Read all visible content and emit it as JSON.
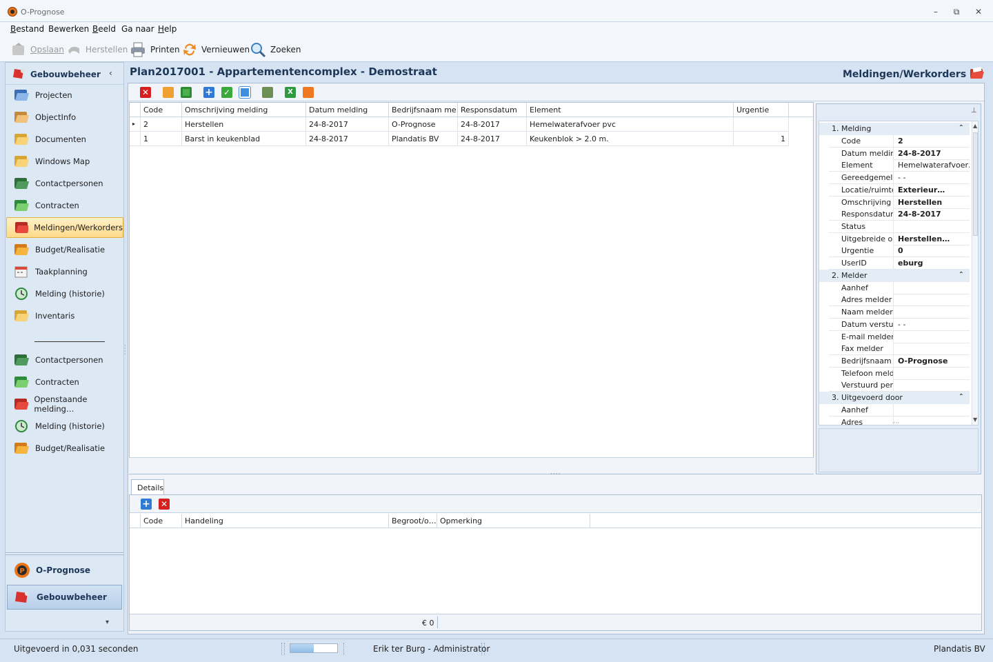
{
  "window": {
    "title": "O-Prognose",
    "minimize": "▭",
    "maximize": "◻",
    "close": "✕"
  },
  "menu": [
    {
      "label": "Bestand",
      "u": "B",
      "rest": "estand"
    },
    {
      "label": "Bewerken",
      "u": "",
      "rest": "Bewerken"
    },
    {
      "label": "Beeld",
      "u": "B",
      "rest": "eeld"
    },
    {
      "label": "Ga naar",
      "u": "",
      "rest": "Ga naar"
    },
    {
      "label": "Help",
      "u": "H",
      "rest": "elp"
    }
  ],
  "toolbar": {
    "save": "Opslaan",
    "undo": "Herstellen",
    "print": "Printen",
    "refresh": "Vernieuwen",
    "search": "Zoeken"
  },
  "sidebar": {
    "title": "Gebouwbeheer",
    "collapse": "‹",
    "items": [
      {
        "label": "Projecten",
        "icon": "projects-icon"
      },
      {
        "label": "ObjectInfo",
        "icon": "objectinfo-icon"
      },
      {
        "label": "Documenten",
        "icon": "folder-icon"
      },
      {
        "label": "Windows Map",
        "icon": "folder-icon"
      },
      {
        "label": "Contactpersonen",
        "icon": "folder-green-icon"
      },
      {
        "label": "Contracten",
        "icon": "folder-check-icon"
      },
      {
        "label": "Meldingen/Werkorders",
        "icon": "folder-red-icon"
      },
      {
        "label": "Budget/Realisatie",
        "icon": "folder-star-icon"
      },
      {
        "label": "Taakplanning",
        "icon": "calendar-icon"
      },
      {
        "label": "Melding (historie)",
        "icon": "history-icon"
      },
      {
        "label": "Inventaris",
        "icon": "folder-icon"
      }
    ],
    "items2": [
      {
        "label": "Contactpersonen",
        "icon": "folder-green-icon"
      },
      {
        "label": "Contracten",
        "icon": "folder-check-icon"
      },
      {
        "label": "Openstaande melding…",
        "icon": "folder-red-icon"
      },
      {
        "label": "Melding (historie)",
        "icon": "history-icon"
      },
      {
        "label": "Budget/Realisatie",
        "icon": "folder-star-icon"
      }
    ],
    "bottom": [
      "O-Prognose",
      "Gebouwbeheer"
    ],
    "more": "▾"
  },
  "main": {
    "title": "Plan2017001 - Appartementencomplex - Demostraat",
    "section": "Meldingen/Werkorders"
  },
  "grid": {
    "columns": [
      "Code",
      "Omschrijving melding",
      "Datum melding",
      "Bedrijfsnaam me…",
      "Responsdatum",
      "Element",
      "Urgentie"
    ],
    "rows": [
      {
        "marker": "▸",
        "cells": [
          "2",
          "Herstellen",
          "24-8-2017",
          "O-Prognose",
          "24-8-2017",
          "Hemelwaterafvoer pvc",
          ""
        ]
      },
      {
        "marker": "",
        "cells": [
          "1",
          "Barst in keukenblad",
          "24-8-2017",
          "Plandatis BV",
          "24-8-2017",
          "Keukenblok > 2.0 m.",
          "1"
        ]
      }
    ]
  },
  "properties": {
    "pin": "⊥",
    "categories": [
      {
        "title": "1. Melding",
        "rows": [
          {
            "k": "Code",
            "v": "2",
            "bold": true
          },
          {
            "k": "Datum melding",
            "v": "24-8-2017",
            "bold": true
          },
          {
            "k": "Element",
            "v": "Hemelwaterafvoer…",
            "bold": false
          },
          {
            "k": "Gereedgemeld",
            "v": "  -  -",
            "bold": false
          },
          {
            "k": "Locatie/ruimte",
            "v": "Exterieur…",
            "bold": true
          },
          {
            "k": "Omschrijving me",
            "v": "Herstellen",
            "bold": true
          },
          {
            "k": "Responsdatum",
            "v": "24-8-2017",
            "bold": true
          },
          {
            "k": "Status",
            "v": "",
            "bold": false
          },
          {
            "k": "Uitgebreide oms",
            "v": "Herstellen…",
            "bold": true
          },
          {
            "k": "Urgentie",
            "v": "0",
            "bold": true
          },
          {
            "k": "UserID",
            "v": "eburg",
            "bold": true
          }
        ]
      },
      {
        "title": "2. Melder",
        "rows": [
          {
            "k": "Aanhef",
            "v": "",
            "bold": false
          },
          {
            "k": "Adres melder",
            "v": "",
            "bold": false
          },
          {
            "k": "Naam melder",
            "v": "",
            "bold": false
          },
          {
            "k": "Datum verstuur",
            "v": "  -  -",
            "bold": false
          },
          {
            "k": "E-mail melder",
            "v": "",
            "bold": false
          },
          {
            "k": "Fax melder",
            "v": "",
            "bold": false
          },
          {
            "k": "Bedrijfsnaam m",
            "v": "O-Prognose",
            "bold": true
          },
          {
            "k": "Telefoon melde",
            "v": "",
            "bold": false
          },
          {
            "k": "Verstuurd per",
            "v": "",
            "bold": false
          }
        ]
      },
      {
        "title": "3. Uitgevoerd door",
        "rows": [
          {
            "k": "Aanhef",
            "v": "",
            "bold": false
          },
          {
            "k": "Adres",
            "v": "",
            "bold": false
          }
        ]
      }
    ]
  },
  "details": {
    "tab": "Details",
    "columns": [
      "Code",
      "Handeling",
      "Begroot/o…",
      "Opmerking"
    ],
    "total": "€ 0"
  },
  "status": {
    "message": "Uitgevoerd in 0,031 seconden",
    "progress": 0.5,
    "user": "Erik ter Burg - Administrator",
    "company": "Plandatis BV"
  },
  "colors": {
    "accent": "#1d3758",
    "active": "#ffd98a",
    "delete": "#d42020",
    "add": "#2f7ad6",
    "ok": "#3aa83a"
  }
}
